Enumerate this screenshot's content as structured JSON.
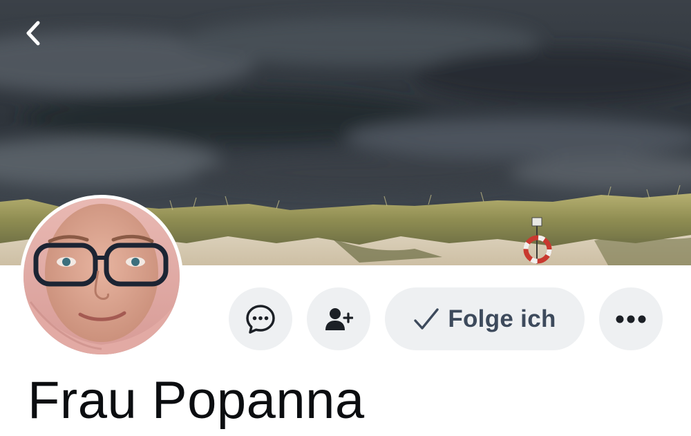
{
  "header": {
    "back_icon": "chevron-left-icon",
    "cover_image": "stormy sky over beach dunes"
  },
  "profile": {
    "name": "Frau Popanna",
    "avatar_image": "woman with glasses and pink scarf"
  },
  "actions": {
    "message_icon": "message-bubble-icon",
    "add_friend_icon": "person-add-icon",
    "following_icon": "checkmark-icon",
    "following_label": "Folge ich",
    "more_icon": "more-horizontal-icon"
  },
  "colors": {
    "button_bg": "#eef0f2",
    "button_fg": "#3d4a5c",
    "name_text": "#0b0d10"
  }
}
